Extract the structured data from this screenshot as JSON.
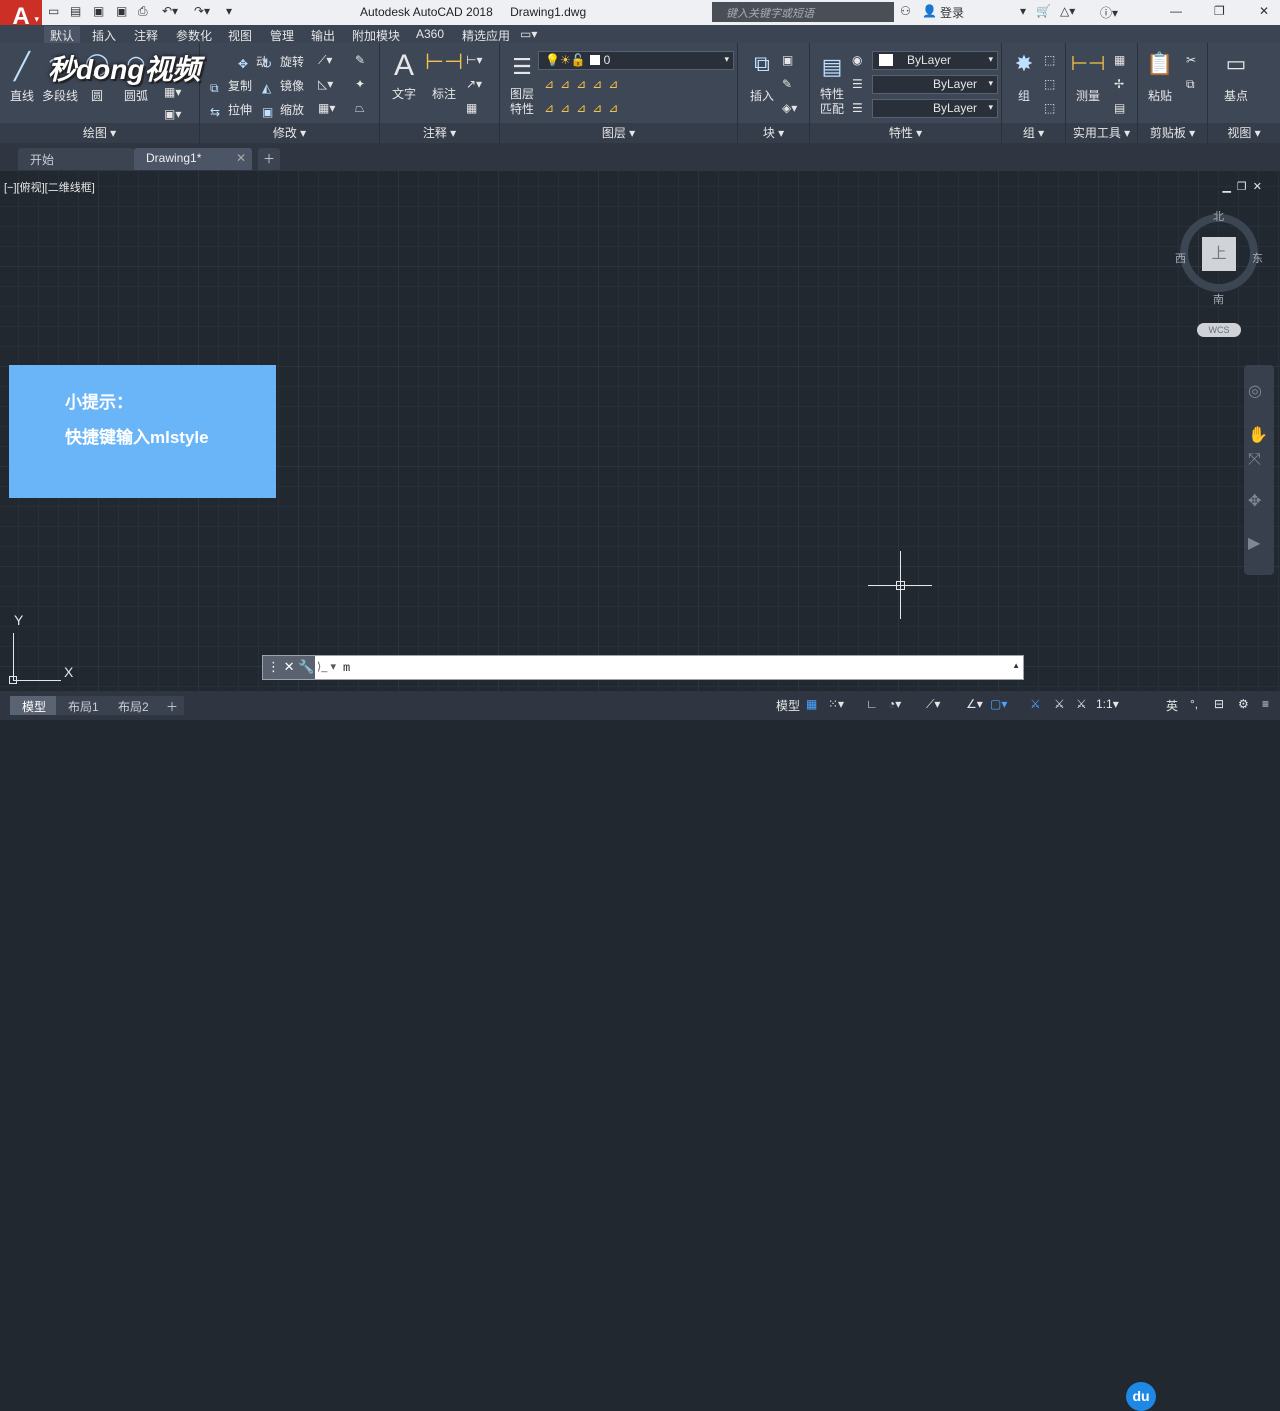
{
  "app": {
    "title": "Autodesk AutoCAD 2018",
    "file": "Drawing1.dwg",
    "app_letter": "A"
  },
  "search": {
    "placeholder": "键入关键字或短语"
  },
  "user": {
    "login": "登录"
  },
  "ribbon_tabs": [
    "默认",
    "插入",
    "注释",
    "参数化",
    "视图",
    "管理",
    "输出",
    "附加模块",
    "A360",
    "精选应用"
  ],
  "ribbon": {
    "draw": {
      "label": "绘图",
      "line": "直线",
      "polyline": "多段线",
      "circle": "圆",
      "arc": "圆弧"
    },
    "modify": {
      "label": "修改",
      "move": "动",
      "rotate": "旋转",
      "copy": "复制",
      "mirror": "镜像",
      "stretch": "拉伸",
      "scale": "缩放"
    },
    "annotation": {
      "label": "注释",
      "text": "文字",
      "dimension": "标注"
    },
    "layers": {
      "label": "图层",
      "props_line1": "图层",
      "props_line2": "特性",
      "current_layer": "0"
    },
    "block": {
      "label": "块",
      "insert": "插入"
    },
    "properties": {
      "label": "特性",
      "match_line1": "特性",
      "match_line2": "匹配",
      "color": "ByLayer",
      "linetype": "ByLayer",
      "lineweight": "ByLayer"
    },
    "groups": {
      "label": "组",
      "group": "组"
    },
    "utilities": {
      "label": "实用工具",
      "measure": "测量"
    },
    "clipboard": {
      "label": "剪贴板",
      "paste": "粘贴"
    },
    "view": {
      "label": "视图",
      "base": "基点"
    }
  },
  "watermark": "秒dong视频",
  "doc_tabs": [
    {
      "label": "开始"
    },
    {
      "label": "Drawing1*"
    }
  ],
  "viewport": {
    "label": "[−][俯视][二维线框]"
  },
  "viewcube": {
    "top": "上",
    "north": "北",
    "south": "南",
    "east": "东",
    "west": "西",
    "wcs": "WCS"
  },
  "tip": {
    "line1": "小提示：",
    "line2": "快捷键输入mlstyle"
  },
  "ucs": {
    "x": "X",
    "y": "Y"
  },
  "command": {
    "value": "m",
    "prompt_icon": "⟩_"
  },
  "layout_tabs": [
    "模型",
    "布局1",
    "布局2"
  ],
  "status": {
    "model": "模型",
    "scale": "1:1",
    "ime": "英"
  },
  "colors": {
    "tip_bg": "#6ab4f8",
    "app_red": "#cc2f25",
    "canvas": "#212830"
  }
}
